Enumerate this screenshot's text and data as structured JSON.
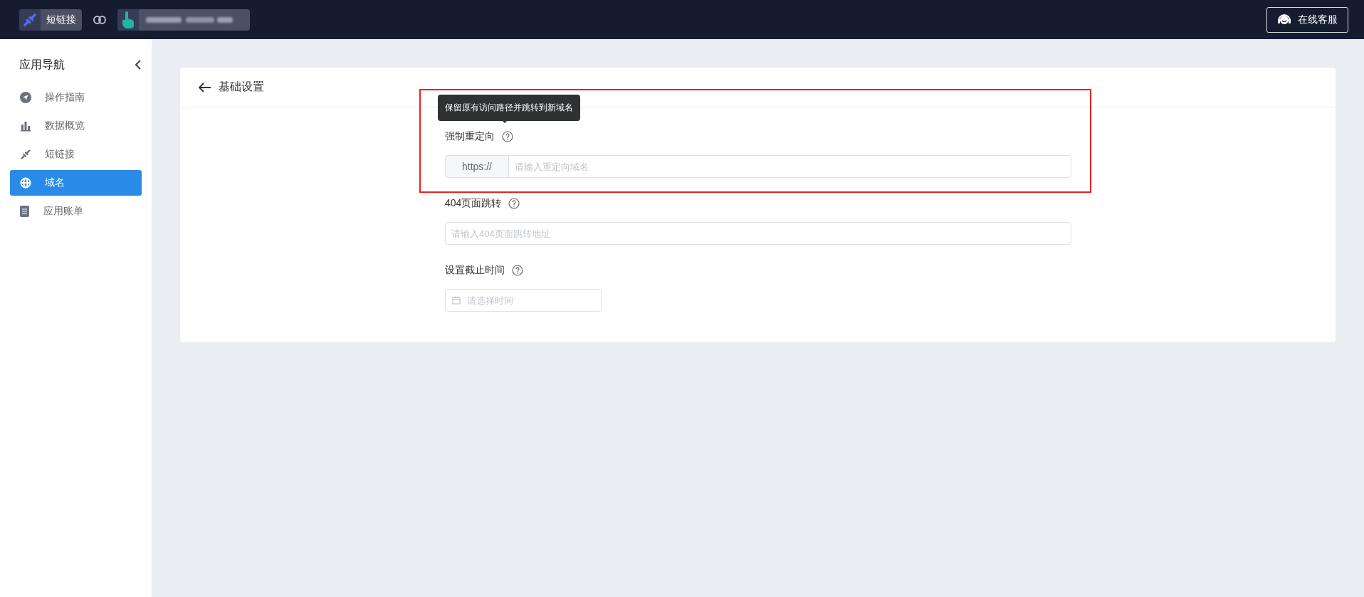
{
  "top_bar": {
    "app_badge": {
      "label": "短链接"
    },
    "support_button": {
      "label": "在线客服"
    }
  },
  "sidebar": {
    "title": "应用导航",
    "items": [
      {
        "label": "操作指南",
        "kind": "guide",
        "selected": false
      },
      {
        "label": "数据概览",
        "kind": "stats",
        "selected": false
      },
      {
        "label": "短链接",
        "kind": "link",
        "selected": false
      },
      {
        "label": "域名",
        "kind": "globe",
        "selected": true
      },
      {
        "label": "应用账单",
        "kind": "bill",
        "selected": false
      }
    ]
  },
  "page": {
    "title": "基础设置",
    "tooltip": "保留原有访问路径并跳转到新域名",
    "fields": [
      {
        "kind": "prefixed",
        "label": "强制重定向",
        "prefix": "https://",
        "placeholder": "请输入重定向域名"
      },
      {
        "kind": "text",
        "label": "404页面跳转",
        "placeholder": "请输入404页面跳转地址"
      },
      {
        "kind": "date",
        "label": "设置截止时间",
        "placeholder": "请选择时间"
      }
    ]
  }
}
